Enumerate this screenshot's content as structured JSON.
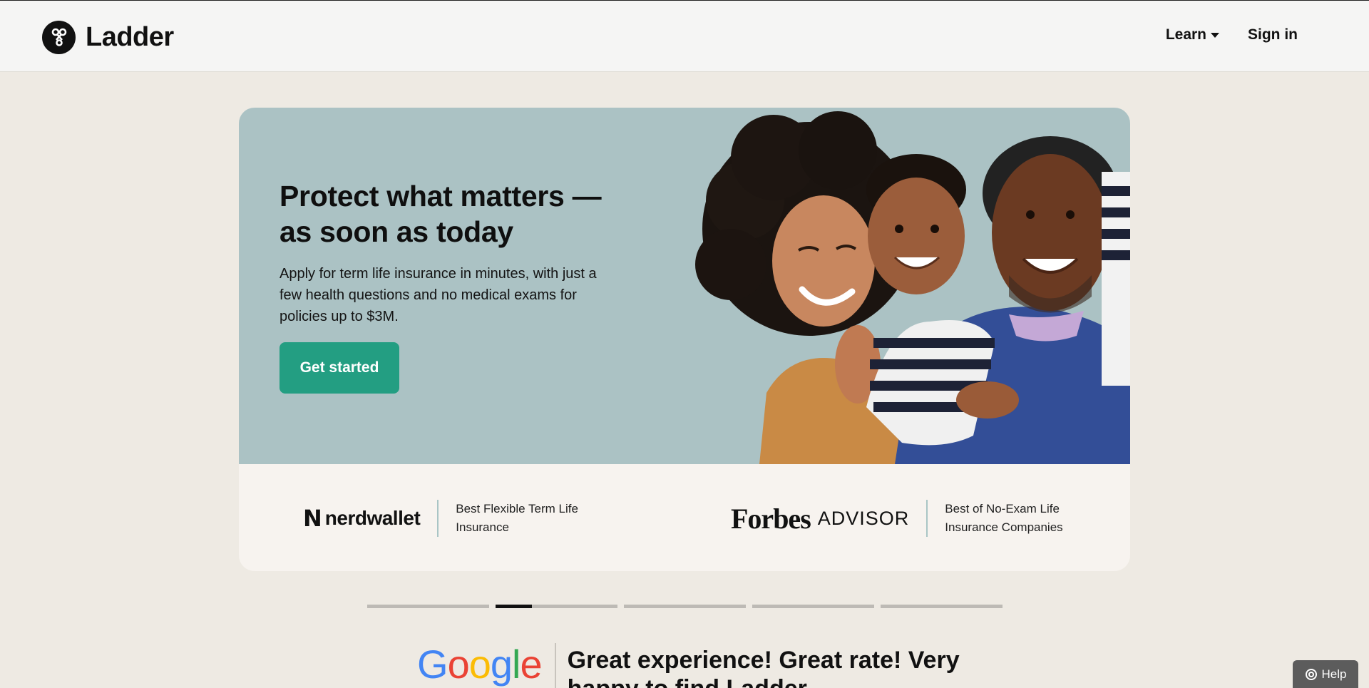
{
  "header": {
    "brand": "Ladder",
    "nav": {
      "learn": "Learn",
      "sign_in": "Sign in"
    }
  },
  "hero": {
    "title": "Protect what matters — as soon as today",
    "subtitle": "Apply for term life insurance in minutes, with just a few health questions and no medical exams for policies up to $3M.",
    "cta": "Get started"
  },
  "awards": [
    {
      "logo_mark": "N",
      "logo_word": "nerdwallet",
      "text": "Best Flexible Term Life Insurance"
    },
    {
      "logo_word": "Forbes",
      "logo_suffix": "ADVISOR",
      "text": "Best of No-Exam Life Insurance Companies"
    }
  ],
  "carousel": {
    "segments": 5,
    "active_index": 1,
    "active_progress": 0.3
  },
  "review": {
    "source": "Google",
    "text": "Great experience! Great rate! Very happy to find Ladder"
  },
  "help": {
    "label": "Help"
  },
  "colors": {
    "page_bg": "#eeeae3",
    "hero_bg": "#abc2c4",
    "cta": "#239e82",
    "awards_bg": "#f7f3ef"
  }
}
